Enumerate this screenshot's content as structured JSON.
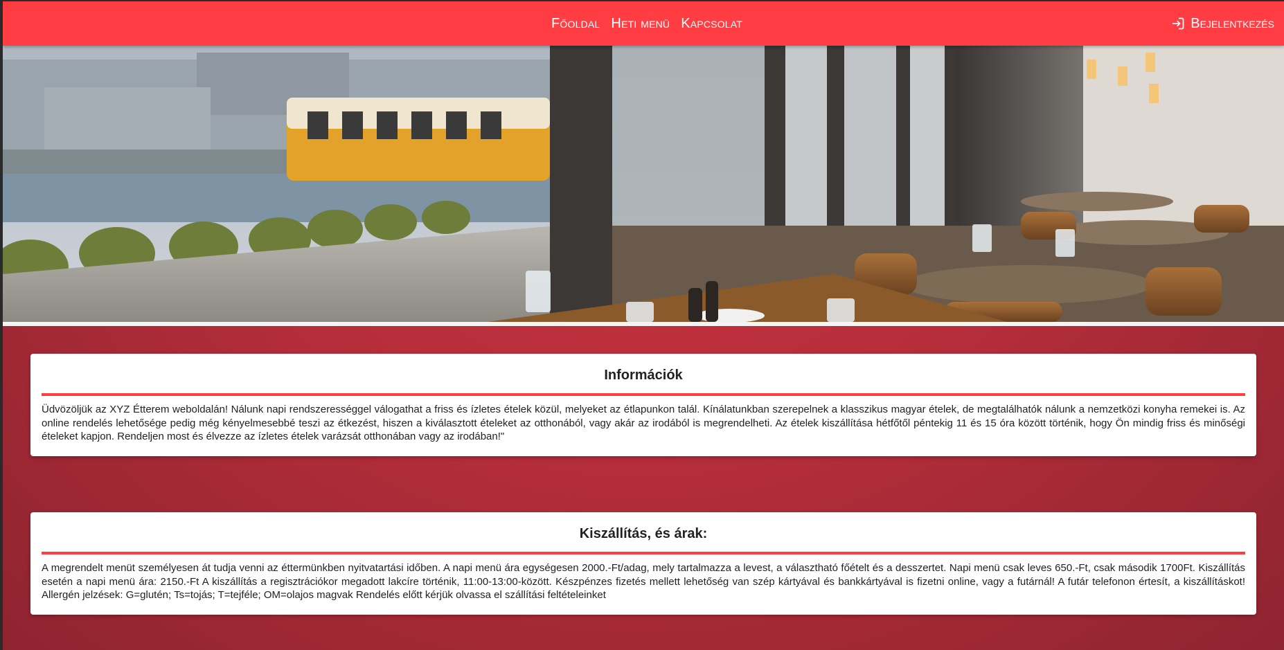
{
  "nav": {
    "links": [
      "Főoldal",
      "Heti menü",
      "Kapcsolat"
    ],
    "login_label": "Bejelentkezés",
    "login_icon": "login-icon"
  },
  "hero": {
    "image": "restaurant-interior-photo"
  },
  "info": {
    "title": "Információk",
    "text": "Üdvözöljük az XYZ Étterem weboldalán! Nálunk napi rendszerességgel válogathat a friss és ízletes ételek közül, melyeket az étlapunkon talál. Kínálatunkban szerepelnek a klasszikus magyar ételek, de megtalálhatók nálunk a nemzetközi konyha remekei is. Az online rendelés lehetősége pedig még kényelmesebbé teszi az étkezést, hiszen a kiválasztott ételeket az otthonából, vagy akár az irodából is megrendelheti. Az ételek kiszállítása hétfőtől péntekig 11 és 15 óra között történik, hogy Ön mindig friss és minőségi ételeket kapjon. Rendeljen most és élvezze az ízletes ételek varázsát otthonában vagy az irodában!\""
  },
  "delivery": {
    "title": "Kiszállítás, és árak:",
    "text": "A megrendelt menüt személyesen át tudja venni az éttermünkben nyitvatartási időben. A napi menü ára egységesen 2000.-Ft/adag, mely tartalmazza a levest, a választható főételt és a desszertet. Napi menü csak leves 650.-Ft, csak második 1700Ft. Kiszállítás esetén a napi menü ára: 2150.-Ft A kiszállítás a regisztrációkor megadott lakcíre történik, 11:00-13:00-között. Készpénzes fizetés mellett lehetőség van szép kártyával és bankkártyával is fizetni online, vagy a futárnál! A futár telefonon értesít, a kiszállításkot! Allergén jelzések: G=glutén; Ts=tojás; T=tejféle; OM=olajos magvak Rendelés előtt kérjük olvassa el szállítási feltételeinket"
  },
  "colors": {
    "accent": "#ff3d43",
    "background": "#b52d3a",
    "card": "#ffffff"
  }
}
